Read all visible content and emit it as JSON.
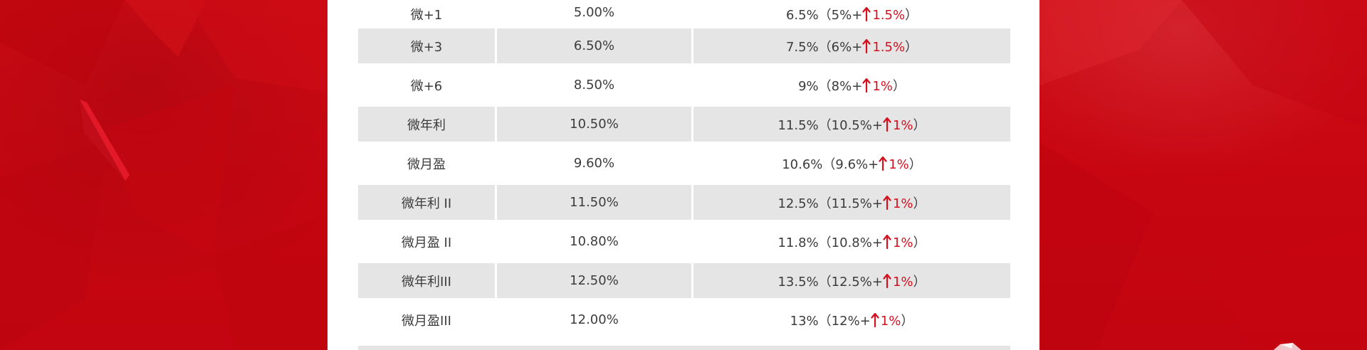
{
  "colors": {
    "background_red": "#c70611",
    "accent_red": "#d5101e",
    "row_gray": "#e5e5e5",
    "text": "#3c3c3c"
  },
  "rates_table": {
    "up_arrow_icon": "up-arrow-icon",
    "rows": [
      {
        "product": "微+1",
        "base_rate": "5.00%",
        "new_rate": "6.5%",
        "formula_base": "（5%+",
        "increase": "1.5%",
        "close": "）"
      },
      {
        "product": "微+3",
        "base_rate": "6.50%",
        "new_rate": "7.5%",
        "formula_base": "（6%+",
        "increase": "1.5%",
        "close": "）"
      },
      {
        "product": "微+6",
        "base_rate": "8.50%",
        "new_rate": "9%",
        "formula_base": "（8%+",
        "increase": "1%",
        "close": "）"
      },
      {
        "product": "微年利",
        "base_rate": "10.50%",
        "new_rate": "11.5%",
        "formula_base": "（10.5%+",
        "increase": "1%",
        "close": "）"
      },
      {
        "product": "微月盈",
        "base_rate": "9.60%",
        "new_rate": "10.6%",
        "formula_base": "（9.6%+",
        "increase": "1%",
        "close": "）"
      },
      {
        "product": "微年利 II",
        "base_rate": "11.50%",
        "new_rate": "12.5%",
        "formula_base": "（11.5%+",
        "increase": "1%",
        "close": "）"
      },
      {
        "product": "微月盈 II",
        "base_rate": "10.80%",
        "new_rate": "11.8%",
        "formula_base": "（10.8%+",
        "increase": "1%",
        "close": "）"
      },
      {
        "product": "微年利III",
        "base_rate": "12.50%",
        "new_rate": "13.5%",
        "formula_base": "（12.5%+",
        "increase": "1%",
        "close": "）"
      },
      {
        "product": "微月盈III",
        "base_rate": "12.00%",
        "new_rate": "13%",
        "formula_base": "（12%+",
        "increase": "1%",
        "close": "）"
      }
    ]
  }
}
